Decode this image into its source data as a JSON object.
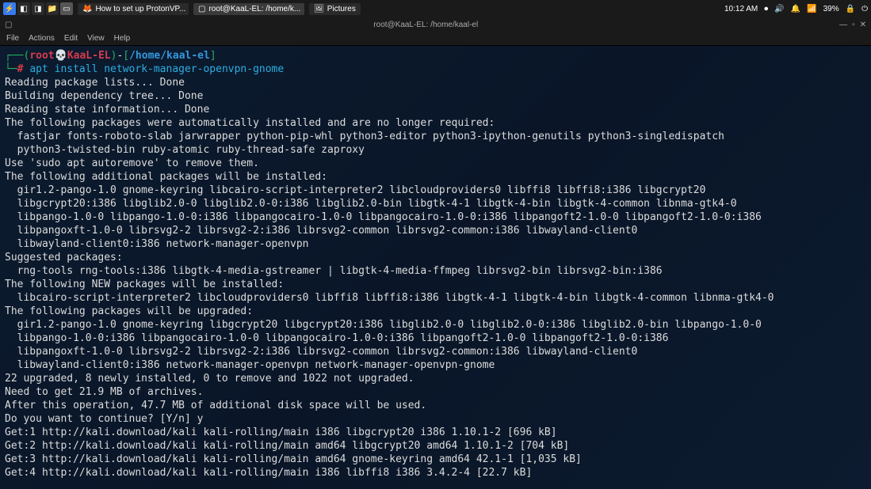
{
  "taskbar": {
    "apps": [
      {
        "icon": "🦊",
        "label": "How to set up ProtonVP..."
      },
      {
        "icon": "▢",
        "label": "root@KaaL-EL: /home/k..."
      },
      {
        "icon": "🖼",
        "label": "Pictures"
      }
    ],
    "time": "10:12 AM",
    "battery": "39%"
  },
  "window": {
    "title": "root@KaaL-EL: /home/kaal-el",
    "menu": [
      "File",
      "Actions",
      "Edit",
      "View",
      "Help"
    ]
  },
  "prompt": {
    "user": "root",
    "skull": "💀",
    "host": "KaaL-EL",
    "path": "/home/kaal-el",
    "hash": "#",
    "command": "apt install network-manager-openvpn-gnome",
    "lb": "(",
    "rb": ")",
    "dash": "-",
    "ob": "[",
    "cb": "]",
    "corner1": "┌──",
    "corner2": "└─"
  },
  "out": {
    "l01": "Reading package lists... Done",
    "l02": "Building dependency tree... Done",
    "l03": "Reading state information... Done",
    "l04": "The following packages were automatically installed and are no longer required:",
    "l05": "  fastjar fonts-roboto-slab jarwrapper python-pip-whl python3-editor python3-ipython-genutils python3-singledispatch",
    "l06": "  python3-twisted-bin ruby-atomic ruby-thread-safe zaproxy",
    "l07": "Use 'sudo apt autoremove' to remove them.",
    "l08": "The following additional packages will be installed:",
    "l09": "  gir1.2-pango-1.0 gnome-keyring libcairo-script-interpreter2 libcloudproviders0 libffi8 libffi8:i386 libgcrypt20",
    "l10": "  libgcrypt20:i386 libglib2.0-0 libglib2.0-0:i386 libglib2.0-bin libgtk-4-1 libgtk-4-bin libgtk-4-common libnma-gtk4-0",
    "l11": "  libpango-1.0-0 libpango-1.0-0:i386 libpangocairo-1.0-0 libpangocairo-1.0-0:i386 libpangoft2-1.0-0 libpangoft2-1.0-0:i386",
    "l12": "  libpangoxft-1.0-0 librsvg2-2 librsvg2-2:i386 librsvg2-common librsvg2-common:i386 libwayland-client0",
    "l13": "  libwayland-client0:i386 network-manager-openvpn",
    "l14": "Suggested packages:",
    "l15": "  rng-tools rng-tools:i386 libgtk-4-media-gstreamer | libgtk-4-media-ffmpeg librsvg2-bin librsvg2-bin:i386",
    "l16": "The following NEW packages will be installed:",
    "l17": "  libcairo-script-interpreter2 libcloudproviders0 libffi8 libffi8:i386 libgtk-4-1 libgtk-4-bin libgtk-4-common libnma-gtk4-0",
    "l18": "The following packages will be upgraded:",
    "l19": "  gir1.2-pango-1.0 gnome-keyring libgcrypt20 libgcrypt20:i386 libglib2.0-0 libglib2.0-0:i386 libglib2.0-bin libpango-1.0-0",
    "l20": "  libpango-1.0-0:i386 libpangocairo-1.0-0 libpangocairo-1.0-0:i386 libpangoft2-1.0-0 libpangoft2-1.0-0:i386",
    "l21": "  libpangoxft-1.0-0 librsvg2-2 librsvg2-2:i386 librsvg2-common librsvg2-common:i386 libwayland-client0",
    "l22": "  libwayland-client0:i386 network-manager-openvpn network-manager-openvpn-gnome",
    "l23": "22 upgraded, 8 newly installed, 0 to remove and 1022 not upgraded.",
    "l24": "Need to get 21.9 MB of archives.",
    "l25": "After this operation, 47.7 MB of additional disk space will be used.",
    "l26": "Do you want to continue? [Y/n] y",
    "l27": "Get:1 http://kali.download/kali kali-rolling/main i386 libgcrypt20 i386 1.10.1-2 [696 kB]",
    "l28": "Get:2 http://kali.download/kali kali-rolling/main amd64 libgcrypt20 amd64 1.10.1-2 [704 kB]",
    "l29": "Get:3 http://kali.download/kali kali-rolling/main amd64 gnome-keyring amd64 42.1-1 [1,035 kB]",
    "l30": "Get:4 http://kali.download/kali kali-rolling/main i386 libffi8 i386 3.4.2-4 [22.7 kB]"
  }
}
